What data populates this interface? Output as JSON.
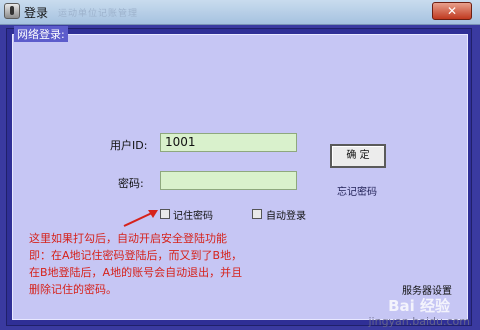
{
  "window": {
    "title": "登录",
    "title_ghost": "运动单位记账管理",
    "close_glyph": "✕"
  },
  "group": {
    "label": "网络登录:"
  },
  "form": {
    "user_label": "用户ID:",
    "user_value": "1001",
    "password_label": "密码:",
    "password_value": "",
    "ok_label": "确 定",
    "forgot_label": "忘记密码",
    "remember_label": "记住密码",
    "remember_checked": false,
    "auto_label": "自动登录",
    "auto_checked": false,
    "settings_label": "服务器设置"
  },
  "annotation": {
    "lines": [
      "这里如果打勾后，自动开启安全登陆功能",
      "即：在A地记住密码登陆后，而又到了B地，",
      "在B地登陆后，A地的账号会自动退出，并且",
      "删除记住的密码。"
    ],
    "color": "#d6221b"
  },
  "watermark": {
    "logo": "Bai 经验",
    "url": "jingyan.baidu.com"
  }
}
